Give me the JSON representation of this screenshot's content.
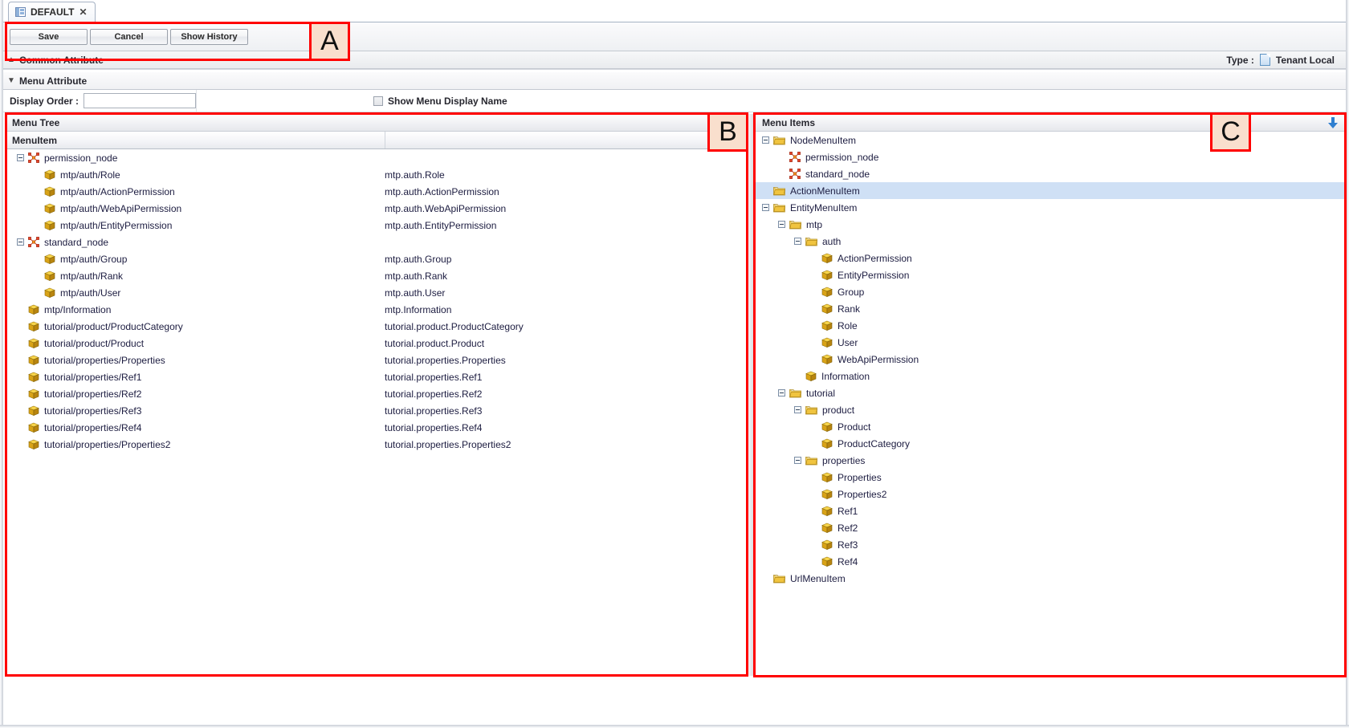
{
  "window": {
    "tab": {
      "label": "DEFAULT",
      "icon": "panel-layout-icon",
      "close_icon": "close-icon"
    }
  },
  "toolbar": {
    "save_label": "Save",
    "cancel_label": "Cancel",
    "show_history_label": "Show History"
  },
  "sections": {
    "common_attribute": {
      "label": "Common Attribute",
      "chevron": "chevron-up-icon"
    },
    "menu_attribute": {
      "label": "Menu Attribute",
      "chevron": "chevron-down-icon"
    }
  },
  "type_field": {
    "label": "Type :",
    "value": "Tenant Local",
    "icon": "document-icon"
  },
  "menu_attribute_form": {
    "display_order_label": "Display Order :",
    "display_order_value": "",
    "display_order_placeholder": "",
    "show_menu_display_name_label": "Show Menu Display Name",
    "show_menu_display_name_checked": false
  },
  "menu_tree_panel": {
    "title": "Menu Tree",
    "column_header": "MenuItem",
    "rows": [
      {
        "indent": 0,
        "expander": "minus",
        "icon": "node-icon",
        "label": "permission_node",
        "path": ""
      },
      {
        "indent": 1,
        "expander": "none",
        "icon": "cube-icon",
        "label": "mtp/auth/Role",
        "path": "mtp.auth.Role"
      },
      {
        "indent": 1,
        "expander": "none",
        "icon": "cube-icon",
        "label": "mtp/auth/ActionPermission",
        "path": "mtp.auth.ActionPermission"
      },
      {
        "indent": 1,
        "expander": "none",
        "icon": "cube-icon",
        "label": "mtp/auth/WebApiPermission",
        "path": "mtp.auth.WebApiPermission"
      },
      {
        "indent": 1,
        "expander": "none",
        "icon": "cube-icon",
        "label": "mtp/auth/EntityPermission",
        "path": "mtp.auth.EntityPermission"
      },
      {
        "indent": 0,
        "expander": "minus",
        "icon": "node-icon",
        "label": "standard_node",
        "path": ""
      },
      {
        "indent": 1,
        "expander": "none",
        "icon": "cube-icon",
        "label": "mtp/auth/Group",
        "path": "mtp.auth.Group"
      },
      {
        "indent": 1,
        "expander": "none",
        "icon": "cube-icon",
        "label": "mtp/auth/Rank",
        "path": "mtp.auth.Rank"
      },
      {
        "indent": 1,
        "expander": "none",
        "icon": "cube-icon",
        "label": "mtp/auth/User",
        "path": "mtp.auth.User"
      },
      {
        "indent": 0,
        "expander": "none",
        "icon": "cube-icon",
        "label": "mtp/Information",
        "path": "mtp.Information"
      },
      {
        "indent": 0,
        "expander": "none",
        "icon": "cube-icon",
        "label": "tutorial/product/ProductCategory",
        "path": "tutorial.product.ProductCategory"
      },
      {
        "indent": 0,
        "expander": "none",
        "icon": "cube-icon",
        "label": "tutorial/product/Product",
        "path": "tutorial.product.Product"
      },
      {
        "indent": 0,
        "expander": "none",
        "icon": "cube-icon",
        "label": "tutorial/properties/Properties",
        "path": "tutorial.properties.Properties"
      },
      {
        "indent": 0,
        "expander": "none",
        "icon": "cube-icon",
        "label": "tutorial/properties/Ref1",
        "path": "tutorial.properties.Ref1"
      },
      {
        "indent": 0,
        "expander": "none",
        "icon": "cube-icon",
        "label": "tutorial/properties/Ref2",
        "path": "tutorial.properties.Ref2"
      },
      {
        "indent": 0,
        "expander": "none",
        "icon": "cube-icon",
        "label": "tutorial/properties/Ref3",
        "path": "tutorial.properties.Ref3"
      },
      {
        "indent": 0,
        "expander": "none",
        "icon": "cube-icon",
        "label": "tutorial/properties/Ref4",
        "path": "tutorial.properties.Ref4"
      },
      {
        "indent": 0,
        "expander": "none",
        "icon": "cube-icon",
        "label": "tutorial/properties/Properties2",
        "path": "tutorial.properties.Properties2"
      }
    ]
  },
  "menu_items_panel": {
    "title": "Menu Items",
    "download_icon": "arrow-down-icon",
    "rows": [
      {
        "indent": 0,
        "expander": "minus",
        "icon": "folder-icon",
        "label": "NodeMenuItem",
        "selected": false
      },
      {
        "indent": 1,
        "expander": "none",
        "icon": "node-icon",
        "label": "permission_node",
        "selected": false
      },
      {
        "indent": 1,
        "expander": "none",
        "icon": "node-icon",
        "label": "standard_node",
        "selected": false
      },
      {
        "indent": 0,
        "expander": "none",
        "icon": "folder-icon",
        "label": "ActionMenuItem",
        "selected": true
      },
      {
        "indent": 0,
        "expander": "minus",
        "icon": "folder-icon",
        "label": "EntityMenuItem",
        "selected": false
      },
      {
        "indent": 1,
        "expander": "minus",
        "icon": "folder-icon",
        "label": "mtp",
        "selected": false
      },
      {
        "indent": 2,
        "expander": "minus",
        "icon": "folder-icon",
        "label": "auth",
        "selected": false
      },
      {
        "indent": 3,
        "expander": "none",
        "icon": "cube-icon",
        "label": "ActionPermission",
        "selected": false
      },
      {
        "indent": 3,
        "expander": "none",
        "icon": "cube-icon",
        "label": "EntityPermission",
        "selected": false
      },
      {
        "indent": 3,
        "expander": "none",
        "icon": "cube-icon",
        "label": "Group",
        "selected": false
      },
      {
        "indent": 3,
        "expander": "none",
        "icon": "cube-icon",
        "label": "Rank",
        "selected": false
      },
      {
        "indent": 3,
        "expander": "none",
        "icon": "cube-icon",
        "label": "Role",
        "selected": false
      },
      {
        "indent": 3,
        "expander": "none",
        "icon": "cube-icon",
        "label": "User",
        "selected": false
      },
      {
        "indent": 3,
        "expander": "none",
        "icon": "cube-icon",
        "label": "WebApiPermission",
        "selected": false
      },
      {
        "indent": 2,
        "expander": "none",
        "icon": "cube-icon",
        "label": "Information",
        "selected": false
      },
      {
        "indent": 1,
        "expander": "minus",
        "icon": "folder-icon",
        "label": "tutorial",
        "selected": false
      },
      {
        "indent": 2,
        "expander": "minus",
        "icon": "folder-icon",
        "label": "product",
        "selected": false
      },
      {
        "indent": 3,
        "expander": "none",
        "icon": "cube-icon",
        "label": "Product",
        "selected": false
      },
      {
        "indent": 3,
        "expander": "none",
        "icon": "cube-icon",
        "label": "ProductCategory",
        "selected": false
      },
      {
        "indent": 2,
        "expander": "minus",
        "icon": "folder-icon",
        "label": "properties",
        "selected": false
      },
      {
        "indent": 3,
        "expander": "none",
        "icon": "cube-icon",
        "label": "Properties",
        "selected": false
      },
      {
        "indent": 3,
        "expander": "none",
        "icon": "cube-icon",
        "label": "Properties2",
        "selected": false
      },
      {
        "indent": 3,
        "expander": "none",
        "icon": "cube-icon",
        "label": "Ref1",
        "selected": false
      },
      {
        "indent": 3,
        "expander": "none",
        "icon": "cube-icon",
        "label": "Ref2",
        "selected": false
      },
      {
        "indent": 3,
        "expander": "none",
        "icon": "cube-icon",
        "label": "Ref3",
        "selected": false
      },
      {
        "indent": 3,
        "expander": "none",
        "icon": "cube-icon",
        "label": "Ref4",
        "selected": false
      },
      {
        "indent": 0,
        "expander": "none",
        "icon": "folder-icon",
        "label": "UrlMenuItem",
        "selected": false
      }
    ]
  },
  "annotations": [
    {
      "letter": "A",
      "target": "toolbar"
    },
    {
      "letter": "B",
      "target": "menu-tree-panel"
    },
    {
      "letter": "C",
      "target": "menu-items-panel"
    }
  ],
  "colors": {
    "annotation_red": "#ff0000",
    "annotation_fill": "#f9dfcd",
    "selection_blue": "#cfe0f5",
    "text": "#1c1c40"
  }
}
